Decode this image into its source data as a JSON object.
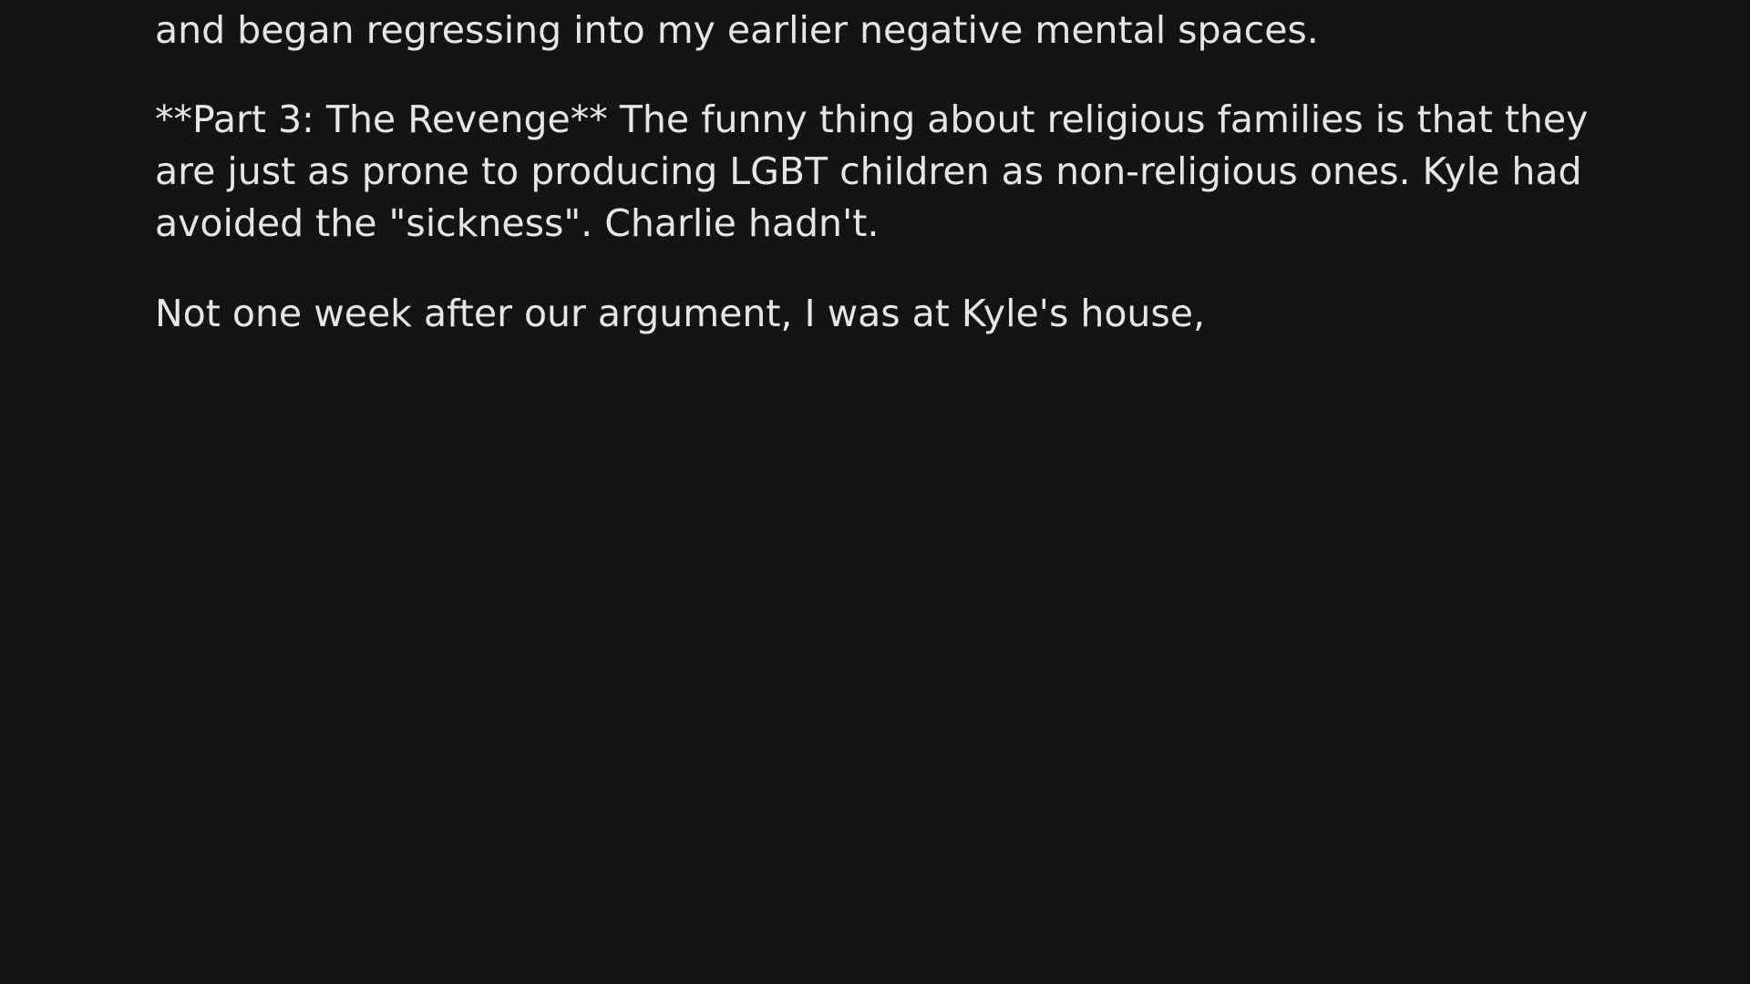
{
  "story": {
    "paragraphs": [
      {
        "lines": [
          "and began regressing into my earlier negative mental spaces."
        ]
      },
      {
        "lines": [
          "**Part 3: The Revenge** The funny thing about religious families is that they",
          "are just as prone to producing LGBT children as non-religious ones. Kyle had",
          "avoided the \"sickness\". Charlie hadn't."
        ]
      },
      {
        "lines": [
          "Not one week after our argument, I was at Kyle's house,"
        ]
      }
    ]
  },
  "colors": {
    "background": "#141414",
    "text": "#e6e6e6"
  }
}
